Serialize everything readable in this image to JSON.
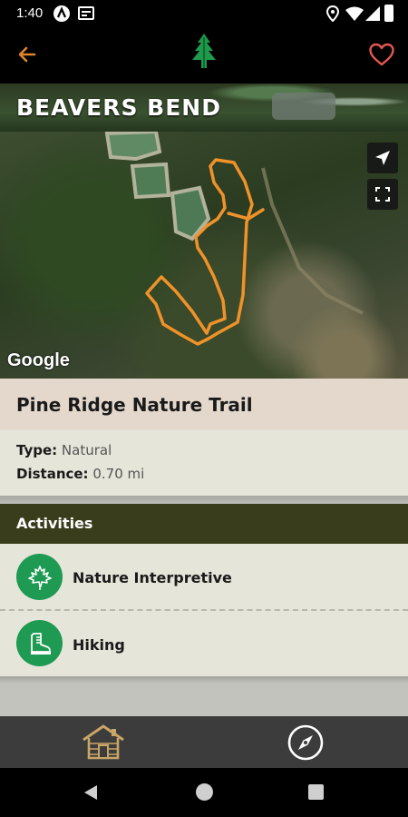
{
  "status_bar": {
    "time": "1:40"
  },
  "header": {
    "park_title": "BEAVERS BEND"
  },
  "map": {
    "attribution": "Google",
    "trail_color": "#f0922a"
  },
  "trail": {
    "name": "Pine Ridge Nature Trail",
    "type_label": "Type:",
    "type_value": "Natural",
    "distance_label": "Distance:",
    "distance_value": "0.70 mi"
  },
  "activities": {
    "title": "Activities",
    "items": [
      {
        "label": "Nature Interpretive",
        "icon": "maple-leaf-icon"
      },
      {
        "label": "Hiking",
        "icon": "hiking-boot-icon"
      }
    ]
  },
  "bottom_nav": [
    {
      "icon": "cabin-icon"
    },
    {
      "icon": "compass-icon"
    }
  ],
  "colors": {
    "accent": "#e0862e",
    "activity_green": "#1e9a52",
    "section_header": "#3a3d1c",
    "tree_green": "#1f9a4d",
    "heart_red": "#e2584f"
  }
}
